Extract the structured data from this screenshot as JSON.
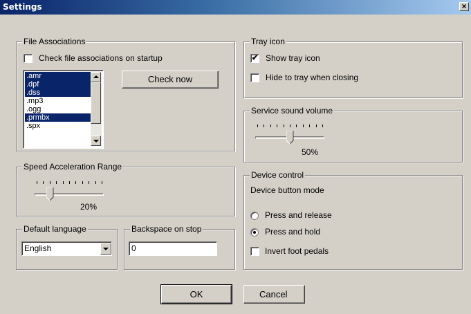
{
  "window": {
    "title": "Settings",
    "close_glyph": "×"
  },
  "file_associations": {
    "title": "File Associations",
    "check_on_startup_label": "Check file associations on startup",
    "check_on_startup": false,
    "check_now_label": "Check now",
    "extensions": [
      {
        "label": ".amr",
        "selected": true
      },
      {
        "label": ".dpf",
        "selected": true
      },
      {
        "label": ".dss",
        "selected": true
      },
      {
        "label": ".mp3",
        "selected": false
      },
      {
        "label": ".ogg",
        "selected": false
      },
      {
        "label": ".prmbx",
        "selected": true
      },
      {
        "label": ".spx",
        "selected": false
      }
    ]
  },
  "speed_range": {
    "title": "Speed Acceleration Range",
    "value_label": "20%",
    "value": 0.2,
    "ticks": 11
  },
  "default_language": {
    "title": "Default language",
    "selected": "English"
  },
  "backspace": {
    "title": "Backspace on stop",
    "value": "0"
  },
  "tray": {
    "title": "Tray icon",
    "show_label": "Show tray icon",
    "show": true,
    "hide_label": "Hide to tray when closing",
    "hide": false
  },
  "service_volume": {
    "title": "Service sound volume",
    "value_label": "50%",
    "value": 0.5,
    "ticks": 11
  },
  "device_control": {
    "title": "Device control",
    "mode_label": "Device button mode",
    "press_release_label": "Press and release",
    "press_hold_label": "Press and hold",
    "selected_mode": "press_hold",
    "invert_label": "Invert foot pedals",
    "invert": false
  },
  "buttons": {
    "ok": "OK",
    "cancel": "Cancel"
  },
  "icons": {
    "check": "✔",
    "scroll_up": "scroll-up-arrow",
    "scroll_down": "scroll-down-arrow",
    "dropdown": "chevron-down"
  }
}
